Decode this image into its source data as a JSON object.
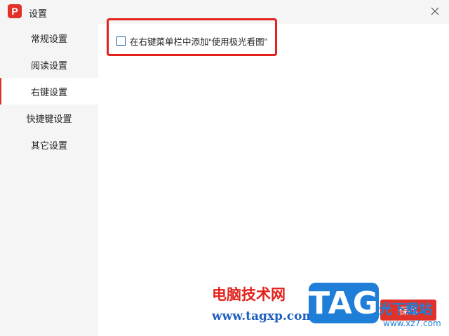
{
  "window": {
    "title": "设置",
    "logo_letter": "P",
    "close_icon": "close-icon"
  },
  "sidebar": {
    "items": [
      {
        "label": "常规设置",
        "active": false
      },
      {
        "label": "阅读设置",
        "active": false
      },
      {
        "label": "右键设置",
        "active": true
      },
      {
        "label": "快捷键设置",
        "active": false
      },
      {
        "label": "其它设置",
        "active": false
      }
    ]
  },
  "main": {
    "option": {
      "label": "在右键菜单栏中添加“使用极光看图”",
      "checked": false
    },
    "save_label": "保存"
  },
  "watermark": {
    "site_cn": "电脑技术网",
    "site_url": "www.tagxp.com",
    "tag": "TAG",
    "site2_cn": "光下载站",
    "site2_url": "www.xz7.com"
  },
  "colors": {
    "accent": "#e0322b",
    "highlight": "#e3221c",
    "checkbox_border": "#1e5aa5",
    "sidebar_bg": "#f5f5f5"
  }
}
